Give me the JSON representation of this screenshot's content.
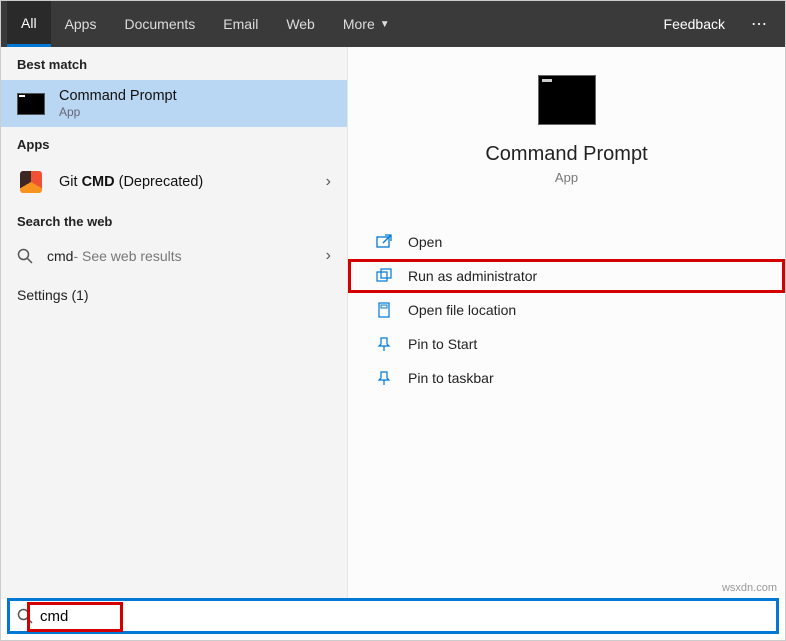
{
  "tabs": {
    "all": "All",
    "apps": "Apps",
    "documents": "Documents",
    "email": "Email",
    "web": "Web",
    "more": "More"
  },
  "header": {
    "feedback": "Feedback"
  },
  "left": {
    "best_match": "Best match",
    "cmd_title": "Command Prompt",
    "cmd_sub": "App",
    "apps_header": "Apps",
    "git_prefix": "Git ",
    "git_bold": "CMD",
    "git_suffix": " (Deprecated)",
    "search_web": "Search the web",
    "web_query": "cmd",
    "web_rest": " - See web results",
    "settings": "Settings (1)"
  },
  "preview": {
    "title": "Command Prompt",
    "sub": "App"
  },
  "actions": {
    "open": "Open",
    "run_admin": "Run as administrator",
    "open_loc": "Open file location",
    "pin_start": "Pin to Start",
    "pin_taskbar": "Pin to taskbar"
  },
  "search": {
    "value": "cmd"
  },
  "watermark": "wsxdn.com"
}
